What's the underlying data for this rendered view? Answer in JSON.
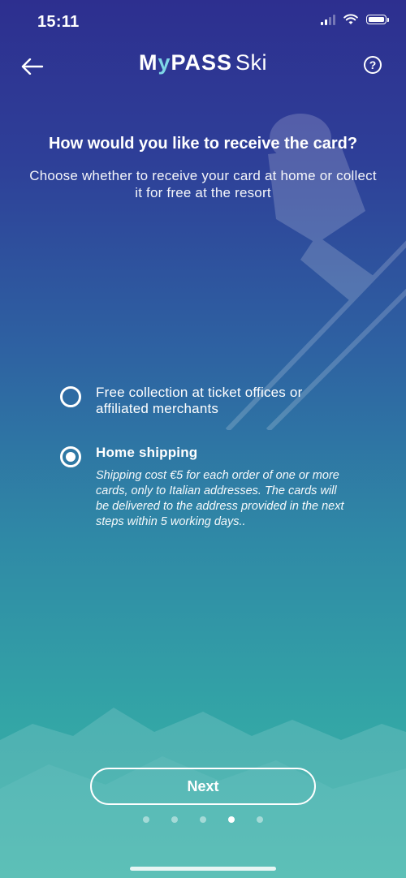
{
  "status_bar": {
    "time": "15:11"
  },
  "header": {
    "logo_brand_part1": "M",
    "logo_brand_y": "y",
    "logo_brand_part2": "PASS",
    "logo_product": "Ski",
    "help_label": "?"
  },
  "content": {
    "title": "How would you like to receive the card?",
    "subtitle": "Choose whether to receive your card at home or collect it for free at the resort"
  },
  "options": [
    {
      "label": "Free collection at ticket offices or affiliated merchants",
      "selected": false
    },
    {
      "label": "Home shipping",
      "description": "Shipping cost €5 for each order of one or more cards, only to Italian addresses. The cards will be delivered to the address provided in the next steps within 5 working days..",
      "selected": true
    }
  ],
  "footer": {
    "next_label": "Next",
    "pagination": {
      "total": 5,
      "current": 4
    }
  },
  "icons": {
    "back": "arrow-left-icon",
    "help": "question-circle-icon",
    "signal": "cellular-signal-icon",
    "wifi": "wifi-icon",
    "battery": "battery-icon"
  },
  "colors": {
    "gradient_top": "#2d2f8f",
    "gradient_bottom": "#3ab2a8",
    "logo_accent": "#7fd6e6",
    "foreground": "#ffffff"
  }
}
